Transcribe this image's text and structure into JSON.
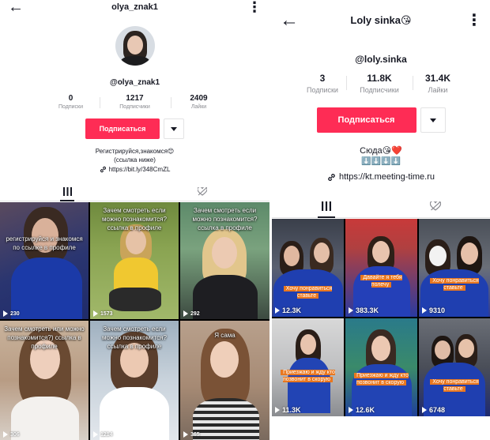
{
  "left": {
    "username": "olya_znak1",
    "handle": "@olya_znak1",
    "stats": [
      {
        "value": "0",
        "label": "Подписки"
      },
      {
        "value": "1217",
        "label": "Подписчики"
      },
      {
        "value": "2409",
        "label": "Лайки"
      }
    ],
    "follow_label": "Подписаться",
    "bio_line1": "Регистрируйся,знакомся😊",
    "bio_line2": "(ссылка ниже)",
    "link": "https://bit.ly/348CmZL",
    "videos": [
      {
        "caption": "регистрируйся и знакомся по ссылке в профиле",
        "views": "230"
      },
      {
        "caption": "Зачем смотреть если можно познакомится? ссылка в профиле",
        "views": "1573"
      },
      {
        "caption": "Зачем смотреть если можно познакомится? ссылка в профиле",
        "views": "292"
      },
      {
        "caption": "Зачем смотреть или можно познакомится?) ссылка в профиле",
        "views": "306"
      },
      {
        "caption": "Зачем смотреть если можно познакомится? ссылка в профиле",
        "views": "1214"
      },
      {
        "caption": "Я сама",
        "views": "365"
      }
    ]
  },
  "right": {
    "username": "Loly sinka😘",
    "handle": "@loly.sinka",
    "stats": [
      {
        "value": "3",
        "label": "Подписки"
      },
      {
        "value": "11.8K",
        "label": "Подписчики"
      },
      {
        "value": "31.4K",
        "label": "Лайки"
      }
    ],
    "follow_label": "Подписаться",
    "bio_line1": "Сюда😘❤️",
    "bio_line2": "⬇️⬇️⬇️⬇️",
    "link": "https://kt.meeting-time.ru",
    "videos": [
      {
        "caption": "Хочу понравиться ставьте",
        "views": "12.3K"
      },
      {
        "caption": "Давайте я тебя полечу",
        "views": "383.3K"
      },
      {
        "caption": "Хочу понравиться ставьте",
        "views": "9310"
      },
      {
        "caption": "Приезжаю и жду кто позвонит в скорую",
        "views": "11.3K"
      },
      {
        "caption": "Приезжаю и жду кто позвонит в скорую",
        "views": "12.6K"
      },
      {
        "caption": "Хочу понравиться ставьте",
        "views": "6748"
      }
    ]
  },
  "icons": {
    "back": "arrow-left-icon",
    "more": "vertical-ellipsis-icon",
    "videos_tab": "grid-icon",
    "liked_tab": "heart-hidden-icon",
    "link": "link-icon",
    "play": "play-icon"
  },
  "colors": {
    "accent": "#fe2c55",
    "caption_box": "#e9771f"
  }
}
